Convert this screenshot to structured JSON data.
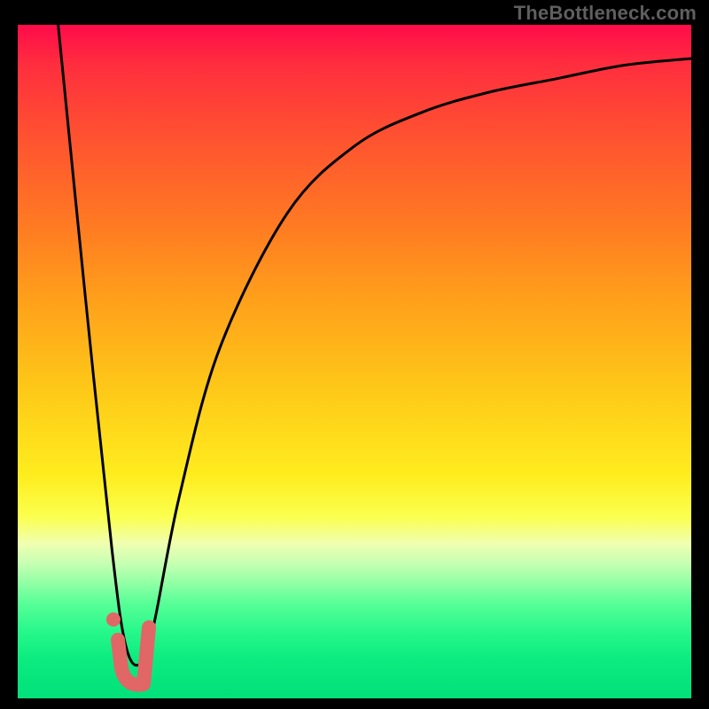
{
  "watermark": "TheBottleneck.com",
  "colors": {
    "accent_marker": "#e16666",
    "curve": "#000000",
    "frame": "#000000"
  },
  "chart_data": {
    "type": "line",
    "title": "",
    "subtitle": "",
    "xlabel": "",
    "ylabel": "",
    "xlim": [
      0,
      100
    ],
    "ylim": [
      0,
      100
    ],
    "grid": false,
    "legend": null,
    "series": [
      {
        "name": "bottleneck-curve",
        "description": "Sharp V-shaped dip with a secondary rising saturating curve. Values read off the visual axes (0–100 each).",
        "x": [
          6,
          10,
          14,
          16,
          18,
          20,
          24,
          30,
          40,
          50,
          60,
          70,
          80,
          90,
          100
        ],
        "values": [
          100,
          60,
          22,
          8,
          5,
          10,
          30,
          52,
          72,
          82,
          87,
          90,
          92,
          94,
          95
        ]
      }
    ],
    "annotations": {
      "minimum": {
        "x": 17,
        "value": 4,
        "marker": "J-hook + dot highlighting the valley"
      }
    },
    "background_gradient": "red (top) → green (bottom), indicating low bottleneck near the valley"
  }
}
